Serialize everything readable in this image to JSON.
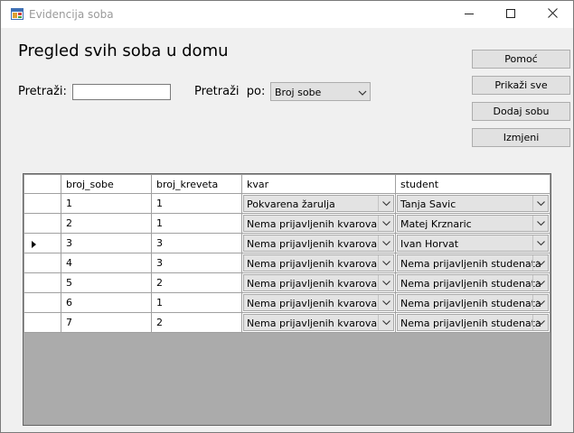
{
  "window": {
    "title": "Evidencija soba"
  },
  "page": {
    "heading": "Pregled svih soba u domu",
    "search_label": "Pretraži:",
    "search_value": "",
    "search_by_label": "Pretraži  po:",
    "search_by_selected": "Broj sobe"
  },
  "buttons": {
    "help": "Pomoć",
    "show_all": "Prikaži sve",
    "add_room": "Dodaj sobu",
    "edit": "Izmjeni"
  },
  "grid": {
    "columns": [
      "broj_sobe",
      "broj_kreveta",
      "kvar",
      "student"
    ],
    "current_row": 2,
    "rows": [
      {
        "broj_sobe": "1",
        "broj_kreveta": "1",
        "kvar": "Pokvarena žarulja",
        "student": "Tanja Savic"
      },
      {
        "broj_sobe": "2",
        "broj_kreveta": "1",
        "kvar": "Nema prijavljenih kvarova",
        "student": "Matej Krznaric"
      },
      {
        "broj_sobe": "3",
        "broj_kreveta": "3",
        "kvar": "Nema prijavljenih kvarova",
        "student": "Ivan Horvat"
      },
      {
        "broj_sobe": "4",
        "broj_kreveta": "3",
        "kvar": "Nema prijavljenih kvarova",
        "student": "Nema prijavljenih studenata"
      },
      {
        "broj_sobe": "5",
        "broj_kreveta": "2",
        "kvar": "Nema prijavljenih kvarova",
        "student": "Nema prijavljenih studenata"
      },
      {
        "broj_sobe": "6",
        "broj_kreveta": "1",
        "kvar": "Nema prijavljenih kvarova",
        "student": "Nema prijavljenih studenata"
      },
      {
        "broj_sobe": "7",
        "broj_kreveta": "2",
        "kvar": "Nema prijavljenih kvarova",
        "student": "Nema prijavljenih studenata"
      }
    ]
  },
  "icons": {
    "app": "app-window-icon",
    "minimize": "minimize-icon",
    "maximize": "maximize-icon",
    "close": "close-icon",
    "dropdown": "chevron-down-icon",
    "row_pointer": "current-row-arrow-icon"
  },
  "colors": {
    "title_text": "#9a9a9a",
    "client_bg": "#f0f0f0",
    "grid_empty_bg": "#ababab",
    "button_bg": "#e1e1e1"
  }
}
